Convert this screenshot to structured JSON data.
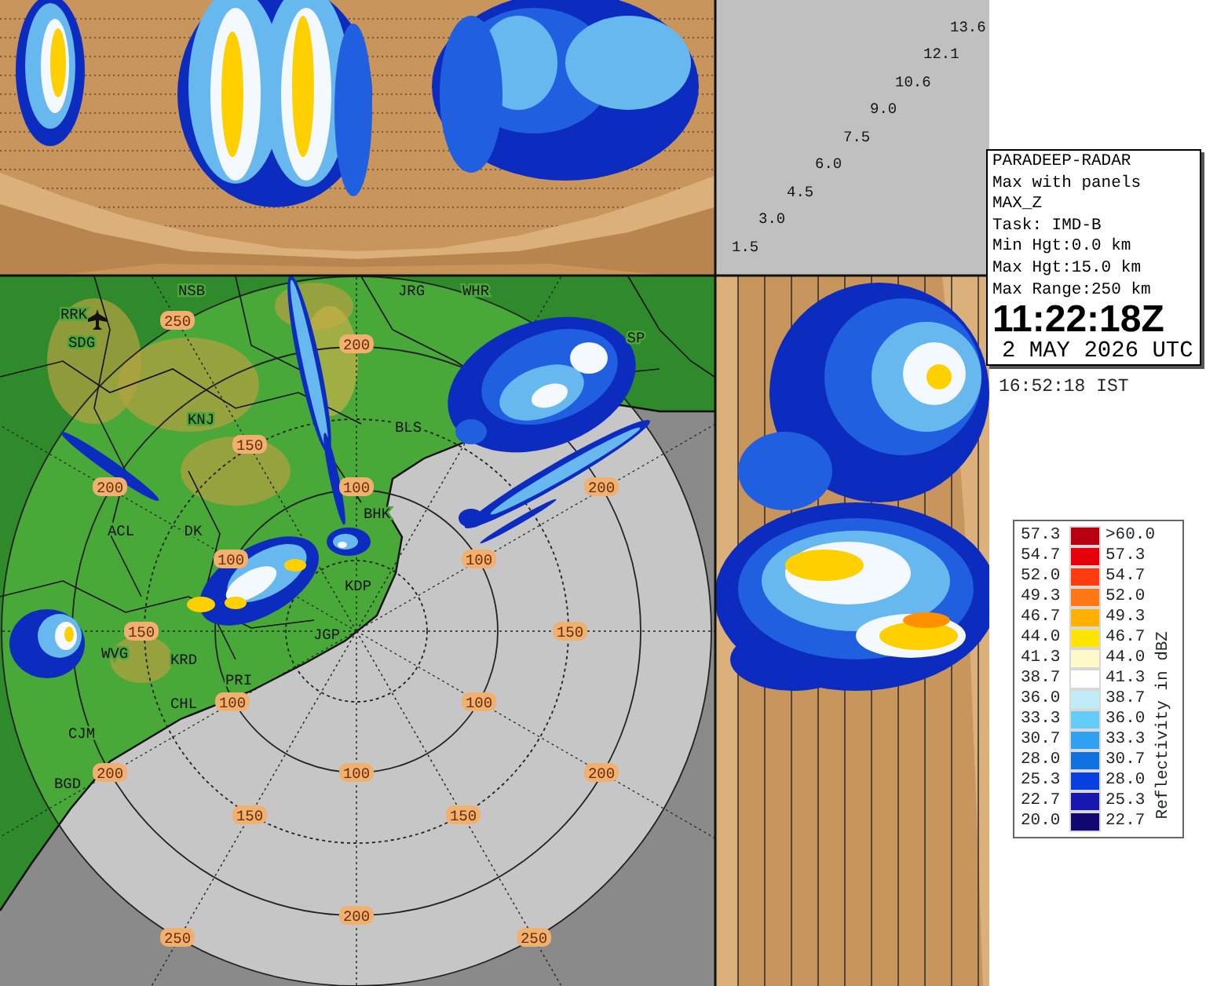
{
  "height_scale": [
    "1.5",
    "3.0",
    "4.5",
    "6.0",
    "7.5",
    "9.0",
    "10.6",
    "12.1",
    "13.6"
  ],
  "info": {
    "lines": [
      "PARADEEP-RADAR",
      "Max with panels",
      "MAX_Z",
      "Task: IMD-B",
      "Min Hgt:0.0 km",
      "Max Hgt:15.0 km",
      "Max Range:250 km"
    ],
    "time_utc": "11:22:18Z",
    "date": "2 MAY 2026 UTC",
    "time_ist": "16:52:18 IST"
  },
  "legend": {
    "title": "Reflectivity in dBZ",
    "rows": [
      {
        "low": "57.3",
        "high": ">60.0",
        "color": "#b80010"
      },
      {
        "low": "54.7",
        "high": "57.3",
        "color": "#e80008"
      },
      {
        "low": "52.0",
        "high": "54.7",
        "color": "#ff3c10"
      },
      {
        "low": "49.3",
        "high": "52.0",
        "color": "#ff7814"
      },
      {
        "low": "46.7",
        "high": "49.3",
        "color": "#ffb000"
      },
      {
        "low": "44.0",
        "high": "46.7",
        "color": "#ffe400"
      },
      {
        "low": "41.3",
        "high": "44.0",
        "color": "#fff8c8"
      },
      {
        "low": "38.7",
        "high": "41.3",
        "color": "#ffffff"
      },
      {
        "low": "36.0",
        "high": "38.7",
        "color": "#c0ecf8"
      },
      {
        "low": "33.3",
        "high": "36.0",
        "color": "#64ccf8"
      },
      {
        "low": "30.7",
        "high": "33.3",
        "color": "#30a0f0"
      },
      {
        "low": "28.0",
        "high": "30.7",
        "color": "#1070e0"
      },
      {
        "low": "25.3",
        "high": "28.0",
        "color": "#0840e0"
      },
      {
        "low": "22.7",
        "high": "25.3",
        "color": "#1818b0"
      },
      {
        "low": "20.0",
        "high": "22.7",
        "color": "#100870"
      }
    ]
  },
  "map": {
    "station_labels": [
      "NSB",
      "JRG",
      "WHR",
      "RRK",
      "SP",
      "SDG",
      "KNJ",
      "BLS",
      "BHK",
      "ACL",
      "DK",
      "KDP",
      "JGP",
      "WVG",
      "KRD",
      "PRI",
      "CHL",
      "CJM",
      "BGD"
    ],
    "range_labels": [
      "250",
      "200",
      "150",
      "200",
      "100",
      "200",
      "100",
      "100",
      "150",
      "150",
      "100",
      "100",
      "200",
      "100",
      "200",
      "150",
      "150",
      "200",
      "250",
      "250"
    ]
  }
}
